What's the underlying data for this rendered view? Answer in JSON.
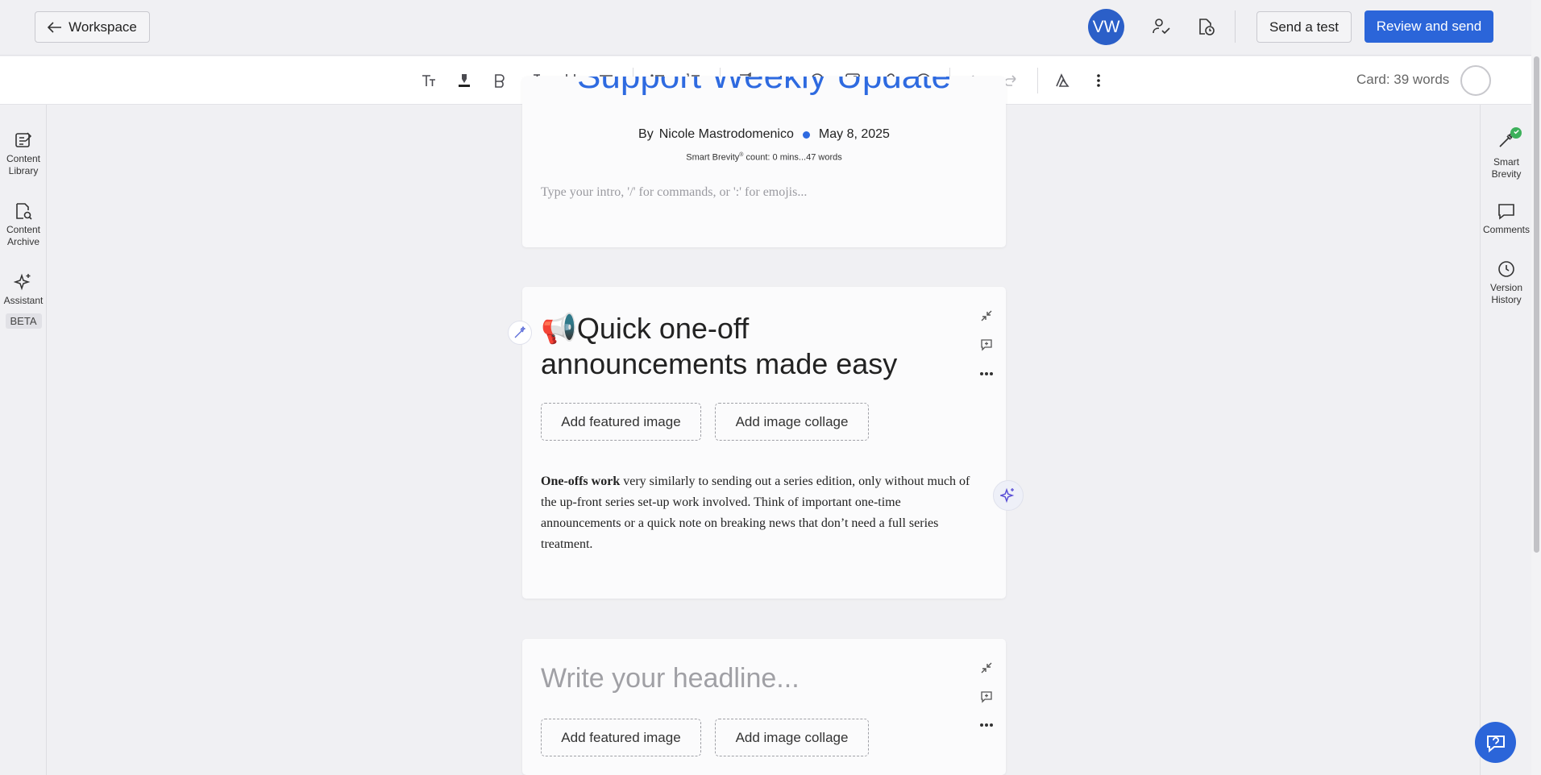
{
  "header": {
    "workspace_label": "Workspace",
    "avatar_initials": "VW",
    "send_test_label": "Send a test",
    "review_send_label": "Review and send"
  },
  "toolbar": {
    "card_count": "Card: 39 words",
    "icons": [
      "text-size-icon",
      "highlight-icon",
      "bold-icon",
      "italic-icon",
      "underline-icon",
      "align-icon",
      "bullet-list-icon",
      "numbered-list-icon",
      "divider-icon",
      "chart-icon",
      "stamp-icon",
      "embed-icon",
      "link-icon",
      "emoji-icon",
      "undo-icon",
      "redo-icon",
      "ai-icon",
      "more-icon"
    ]
  },
  "left_rail": {
    "items": [
      {
        "label": "Content Library"
      },
      {
        "label": "Content Archive"
      },
      {
        "label": "Assistant",
        "badge": "BETA"
      }
    ]
  },
  "right_rail": {
    "items": [
      {
        "label": "Smart Brevity"
      },
      {
        "label": "Comments"
      },
      {
        "label": "Version History"
      }
    ]
  },
  "card1": {
    "title": "Support Weekly Update",
    "by": "By",
    "author": "Nicole Mastrodomenico",
    "date": "May 8, 2025",
    "brevity_prefix": "Smart Brevity",
    "brevity_mark": "®",
    "brevity_suffix": " count: 0 mins...47 words",
    "intro_placeholder": "Type your intro, '/' for commands, or ':' for emojis..."
  },
  "card2": {
    "emoji": "📢",
    "headline": "Quick one-off announcements made easy",
    "featured_image_label": "Add featured image",
    "image_collage_label": "Add image collage",
    "body_bold": "One-offs work",
    "body_rest": " very similarly to sending out a series edition, only without much of the up-front series set-up work involved. Think of important one-time announcements or a quick note on breaking news that don’t need a full series treatment."
  },
  "card3": {
    "headline_placeholder": "Write your headline...",
    "featured_image_label": "Add featured image",
    "image_collage_label": "Add image collage"
  },
  "colors": {
    "accent": "#2b65d9",
    "title": "#2e6ae0",
    "check": "#3cb05a"
  }
}
